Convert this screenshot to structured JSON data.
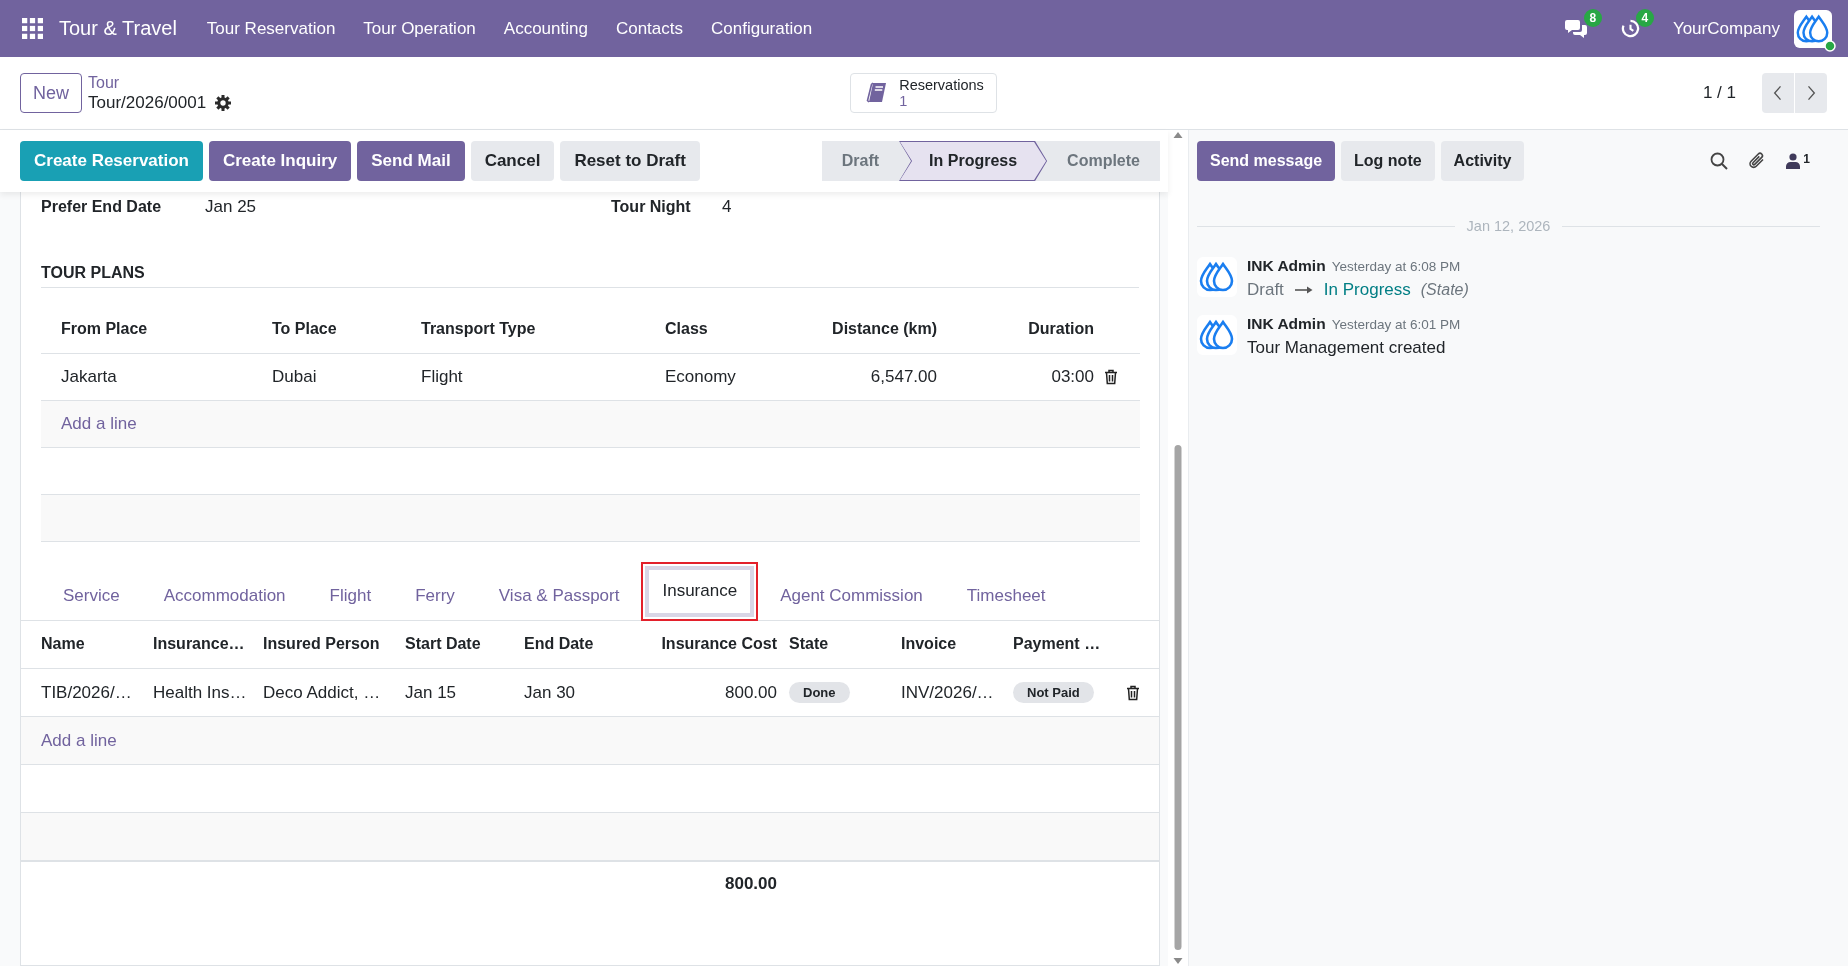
{
  "navbar": {
    "app_name": "Tour & Travel",
    "menu": [
      "Tour Reservation",
      "Tour Operation",
      "Accounting",
      "Contacts",
      "Configuration"
    ],
    "indicators": [
      {
        "kind": "messages",
        "count": "8"
      },
      {
        "kind": "activities",
        "count": "4"
      }
    ],
    "company": "YourCompany"
  },
  "control_panel": {
    "new_button": "New",
    "breadcrumb": "Tour",
    "record_name": "Tour/2026/0001",
    "stat_button": {
      "label": "Reservations",
      "value": "1"
    },
    "pager": "1 / 1"
  },
  "action_buttons": [
    {
      "label": "Create Reservation",
      "kind": "info"
    },
    {
      "label": "Create Inquiry",
      "kind": "primary"
    },
    {
      "label": "Send Mail",
      "kind": "primary"
    },
    {
      "label": "Cancel",
      "kind": "secondary"
    },
    {
      "label": "Reset to Draft",
      "kind": "secondary"
    }
  ],
  "status_bar": [
    {
      "label": "Draft",
      "selected": false
    },
    {
      "label": "In Progress",
      "selected": true
    },
    {
      "label": "Complete",
      "selected": false
    }
  ],
  "fields": [
    {
      "label": "Prefer End Date",
      "value": "Jan 25"
    },
    {
      "label": "Tour Night",
      "value": "4"
    }
  ],
  "tour_plans": {
    "title": "TOUR PLANS",
    "columns": [
      {
        "label": "From Place",
        "kind": "text"
      },
      {
        "label": "To Place",
        "kind": "text"
      },
      {
        "label": "Transport Type",
        "kind": "text"
      },
      {
        "label": "Class",
        "kind": "text"
      },
      {
        "label": "Distance (km)",
        "kind": "number"
      },
      {
        "label": "Duration",
        "kind": "number"
      }
    ],
    "rows": [
      [
        "Jakarta",
        "Dubai",
        "Flight",
        "Economy",
        "6,547.00",
        "03:00"
      ]
    ],
    "add_line": "Add a line"
  },
  "notebook": {
    "tabs": [
      {
        "label": "Service",
        "selected": false,
        "highlighted": false
      },
      {
        "label": "Accommodation",
        "selected": false,
        "highlighted": false
      },
      {
        "label": "Flight",
        "selected": false,
        "highlighted": false
      },
      {
        "label": "Ferry",
        "selected": false,
        "highlighted": false
      },
      {
        "label": "Visa & Passport",
        "selected": false,
        "highlighted": false
      },
      {
        "label": "Insurance",
        "selected": true,
        "highlighted": true
      },
      {
        "label": "Agent Commission",
        "selected": false,
        "highlighted": false
      },
      {
        "label": "Timesheet",
        "selected": false,
        "highlighted": false
      }
    ],
    "table": {
      "columns": [
        {
          "label": "Name",
          "kind": "text"
        },
        {
          "label": "Insurance…",
          "kind": "text"
        },
        {
          "label": "Insured Person",
          "kind": "text"
        },
        {
          "label": "Start Date",
          "kind": "text"
        },
        {
          "label": "End Date",
          "kind": "text"
        },
        {
          "label": "Insurance Cost",
          "kind": "number"
        },
        {
          "label": "State",
          "kind": "badge"
        },
        {
          "label": "Invoice",
          "kind": "text"
        },
        {
          "label": "Payment …",
          "kind": "badge"
        }
      ],
      "rows": [
        [
          "TIB/2026/…",
          "Health Ins…",
          "Deco Addict, …",
          "Jan 15",
          "Jan 30",
          "800.00",
          "Done",
          "INV/2026/…",
          "Not Paid"
        ]
      ],
      "add_line": "Add a line",
      "total": "800.00"
    }
  },
  "chatter": {
    "buttons": [
      {
        "label": "Send message",
        "kind": "primary"
      },
      {
        "label": "Log note",
        "kind": "secondary"
      },
      {
        "label": "Activity",
        "kind": "secondary"
      }
    ],
    "followers_count": "1",
    "date": "Jan 12, 2026",
    "messages": [
      {
        "kind": "tracking",
        "author": "INK Admin",
        "time": "Yesterday at 6:08 PM",
        "old_value": "Draft",
        "new_value": "In Progress",
        "field": "(State)"
      },
      {
        "kind": "text",
        "author": "INK Admin",
        "time": "Yesterday at 6:01 PM",
        "body": "Tour Management created"
      }
    ]
  }
}
